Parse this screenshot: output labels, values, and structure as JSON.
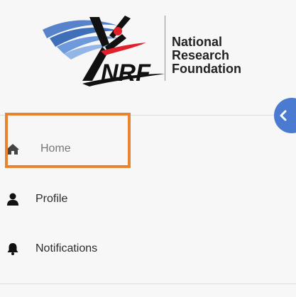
{
  "logo": {
    "acronym": "NRF",
    "name_line1": "National",
    "name_line2": "Research",
    "name_line3": "Foundation"
  },
  "collapse_button": {
    "icon": "chevron-left-icon"
  },
  "nav": {
    "items": [
      {
        "label": "Home",
        "icon": "home-icon",
        "highlighted": true
      },
      {
        "label": "Profile",
        "icon": "user-icon",
        "highlighted": false
      },
      {
        "label": "Notifications",
        "icon": "bell-icon",
        "highlighted": false
      }
    ]
  },
  "colors": {
    "accent": "#4a7bd0",
    "highlight": "#e8842e",
    "logo_blue": "#2a5fb0",
    "logo_red": "#e0202a"
  }
}
